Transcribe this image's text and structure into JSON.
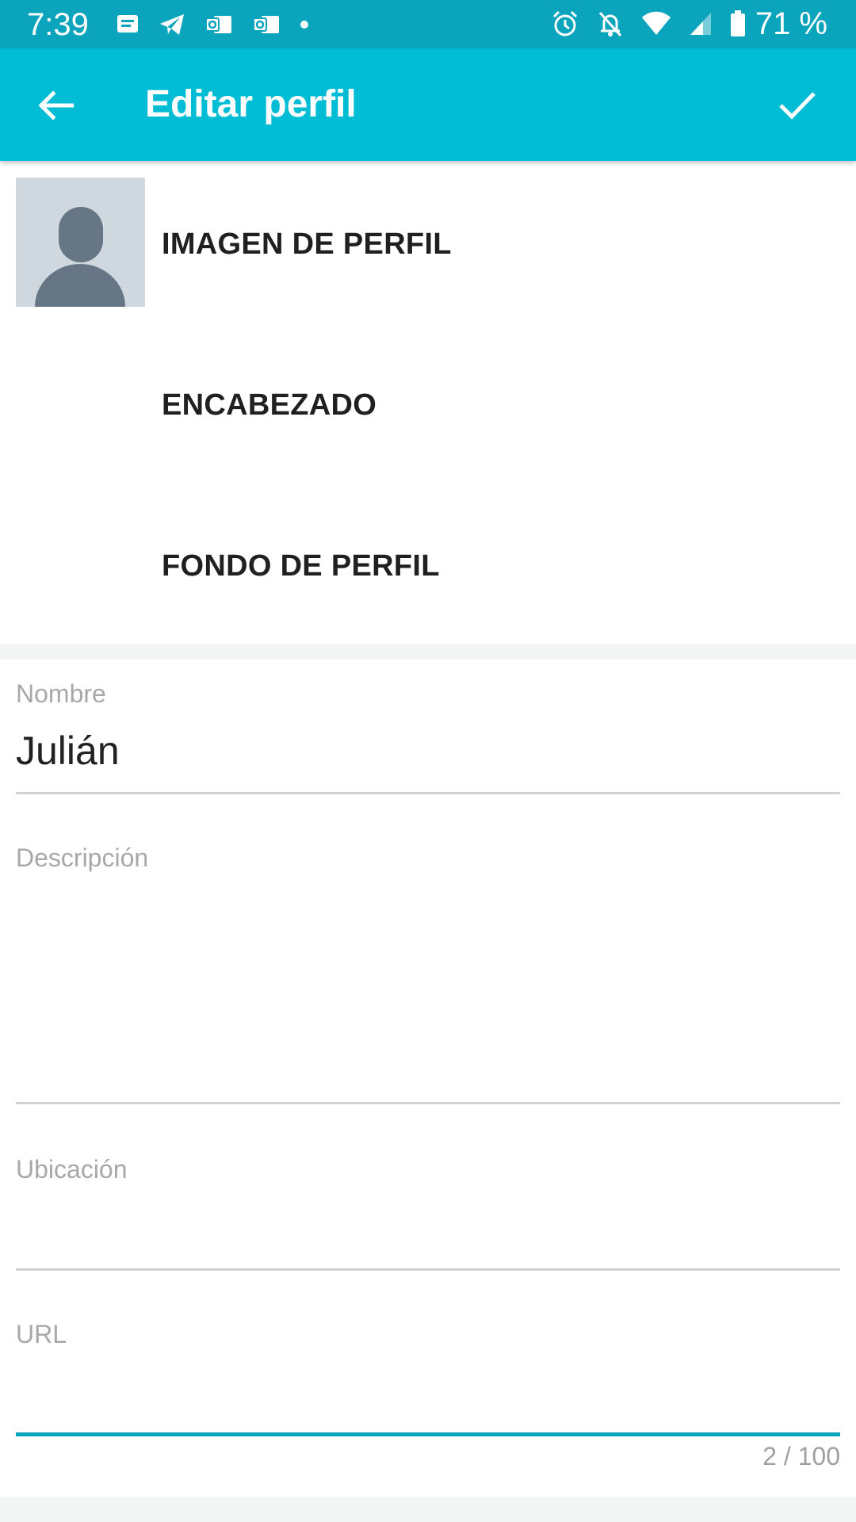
{
  "status_bar": {
    "time": "7:39",
    "battery_percent": "71 %",
    "left_icons": [
      "message-icon",
      "telegram-icon",
      "outlook-icon",
      "outlook-icon",
      "dot-icon"
    ],
    "right_icons": [
      "alarm-icon",
      "bell-off-icon",
      "wifi-icon",
      "signal-icon",
      "battery-icon"
    ]
  },
  "app_bar": {
    "title": "Editar perfil",
    "back_icon": "arrow-back-icon",
    "done_icon": "check-icon"
  },
  "image_options": [
    {
      "label": "IMAGEN DE PERFIL",
      "has_thumbnail": true
    },
    {
      "label": "ENCABEZADO",
      "has_thumbnail": false
    },
    {
      "label": "FONDO DE PERFIL",
      "has_thumbnail": false
    }
  ],
  "form": {
    "name": {
      "label": "Nombre",
      "value": "Julián"
    },
    "description": {
      "label": "Descripción",
      "value": ""
    },
    "location": {
      "label": "Ubicación",
      "value": ""
    },
    "url": {
      "label": "URL",
      "value": "",
      "counter": "2 / 100"
    }
  },
  "colors": {
    "status_bar": "#0aa4bd",
    "app_bar": "#00bcd4",
    "accent": "#0aa4bd"
  }
}
